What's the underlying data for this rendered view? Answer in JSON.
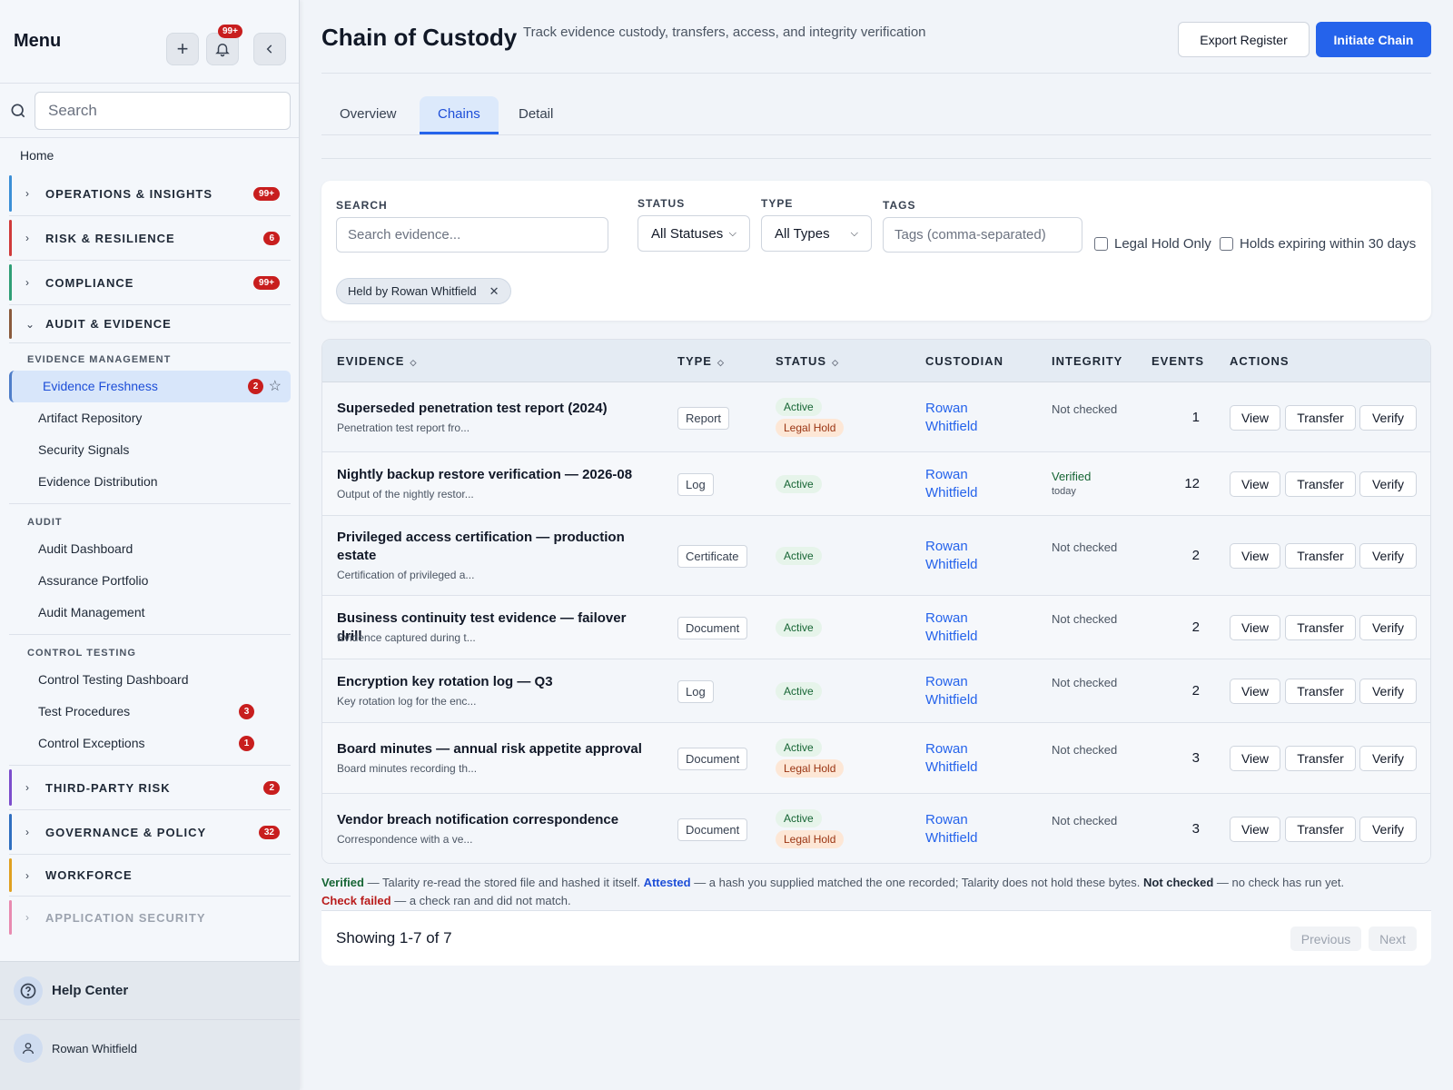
{
  "sidebar": {
    "title": "Menu",
    "bell_badge": "99+",
    "search_placeholder": "Search",
    "home": "Home",
    "groups_top": [
      {
        "label": "OPERATIONS & INSIGHTS",
        "badge": "99+",
        "color": "#3b8fd6"
      },
      {
        "label": "RISK & RESILIENCE",
        "badge": "6",
        "color": "#d03a3a"
      },
      {
        "label": "COMPLIANCE",
        "badge": "99+",
        "color": "#2f9e76"
      },
      {
        "label": "AUDIT & EVIDENCE",
        "badge": "",
        "color": "#8a5a3c"
      }
    ],
    "evidence_management": {
      "heading": "EVIDENCE MANAGEMENT",
      "items": [
        {
          "label": "Evidence Freshness",
          "badge": "2"
        },
        {
          "label": "Artifact Repository"
        },
        {
          "label": "Security Signals"
        },
        {
          "label": "Evidence Distribution"
        }
      ]
    },
    "audit": {
      "heading": "AUDIT",
      "items": [
        {
          "label": "Audit Dashboard"
        },
        {
          "label": "Assurance Portfolio"
        },
        {
          "label": "Audit Management"
        }
      ]
    },
    "control_testing": {
      "heading": "CONTROL TESTING",
      "items": [
        {
          "label": "Control Testing Dashboard"
        },
        {
          "label": "Test Procedures",
          "badge": "3"
        },
        {
          "label": "Control Exceptions",
          "badge": "1"
        }
      ]
    },
    "groups_bottom": [
      {
        "label": "THIRD-PARTY RISK",
        "badge": "2",
        "color": "#7c4dcc"
      },
      {
        "label": "GOVERNANCE & POLICY",
        "badge": "32",
        "color": "#2f6fc0"
      },
      {
        "label": "WORKFORCE",
        "badge": "",
        "color": "#e0a020"
      },
      {
        "label": "APPLICATION SECURITY",
        "badge": "",
        "color": "#e88ab0"
      }
    ],
    "help": "Help Center",
    "user": "Rowan Whitfield"
  },
  "header": {
    "title": "Chain of Custody",
    "subtitle": "Track evidence custody, transfers, access, and integrity verification",
    "export_label": "Export Register",
    "initiate_label": "Initiate Chain"
  },
  "tabs": [
    "Overview",
    "Chains",
    "Detail"
  ],
  "filters": {
    "search_label": "SEARCH",
    "search_placeholder": "Search evidence...",
    "status_label": "STATUS",
    "status_value": "All Statuses",
    "type_label": "TYPE",
    "type_value": "All Types",
    "tags_label": "TAGS",
    "tags_placeholder": "Tags (comma-separated)",
    "legal_hold": "Legal Hold Only",
    "expiring": "Holds expiring within 30 days",
    "chip": "Held by Rowan Whitfield"
  },
  "table": {
    "headers": {
      "evidence": "EVIDENCE",
      "type": "TYPE",
      "status": "STATUS",
      "custodian": "CUSTODIAN",
      "integrity": "INTEGRITY",
      "events": "EVENTS",
      "actions": "ACTIONS"
    },
    "action_labels": {
      "view": "View",
      "transfer": "Transfer",
      "verify": "Verify"
    },
    "rows": [
      {
        "title": "Superseded penetration test report (2024)",
        "desc": "Penetration test report fro...",
        "type": "Report",
        "status": "Active",
        "hold": "Legal Hold",
        "custodian": "Rowan Whitfield",
        "integrity": "Not checked",
        "integrity_sub": "",
        "events": "1"
      },
      {
        "title": "Nightly backup restore verification — 2026-08",
        "desc": "Output of the nightly restor...",
        "type": "Log",
        "status": "Active",
        "hold": "",
        "custodian": "Rowan Whitfield",
        "integrity": "Verified",
        "integrity_sub": "today",
        "events": "12"
      },
      {
        "title": "Privileged access certification — production estate",
        "desc": "Certification of privileged a...",
        "type": "Certificate",
        "status": "Active",
        "hold": "",
        "custodian": "Rowan Whitfield",
        "integrity": "Not checked",
        "integrity_sub": "",
        "events": "2"
      },
      {
        "title": "Business continuity test evidence — failover drill",
        "desc": "Evidence captured during t...",
        "type": "Document",
        "status": "Active",
        "hold": "",
        "custodian": "Rowan Whitfield",
        "integrity": "Not checked",
        "integrity_sub": "",
        "events": "2"
      },
      {
        "title": "Encryption key rotation log — Q3",
        "desc": "Key rotation log for the enc...",
        "type": "Log",
        "status": "Active",
        "hold": "",
        "custodian": "Rowan Whitfield",
        "integrity": "Not checked",
        "integrity_sub": "",
        "events": "2"
      },
      {
        "title": "Board minutes — annual risk appetite approval",
        "desc": "Board minutes recording th...",
        "type": "Document",
        "status": "Active",
        "hold": "Legal Hold",
        "custodian": "Rowan Whitfield",
        "integrity": "Not checked",
        "integrity_sub": "",
        "events": "3"
      },
      {
        "title": "Vendor breach notification correspondence",
        "desc": "Correspondence with a ve...",
        "type": "Document",
        "status": "Active",
        "hold": "Legal Hold",
        "custodian": "Rowan Whitfield",
        "integrity": "Not checked",
        "integrity_sub": "",
        "events": "3"
      }
    ]
  },
  "legend": {
    "verified": "Verified",
    "verified_text": " — Talarity re-read the stored file and hashed it itself. ",
    "attested": "Attested",
    "attested_text": " — a hash you supplied matched the one recorded; Talarity does not hold these bytes. ",
    "not_checked": "Not checked",
    "not_checked_text": " — no check has run yet.",
    "failed": "Check failed",
    "failed_text": " — a check ran and did not match."
  },
  "pagination": {
    "showing": "Showing 1-7 of 7",
    "previous": "Previous",
    "next": "Next"
  }
}
